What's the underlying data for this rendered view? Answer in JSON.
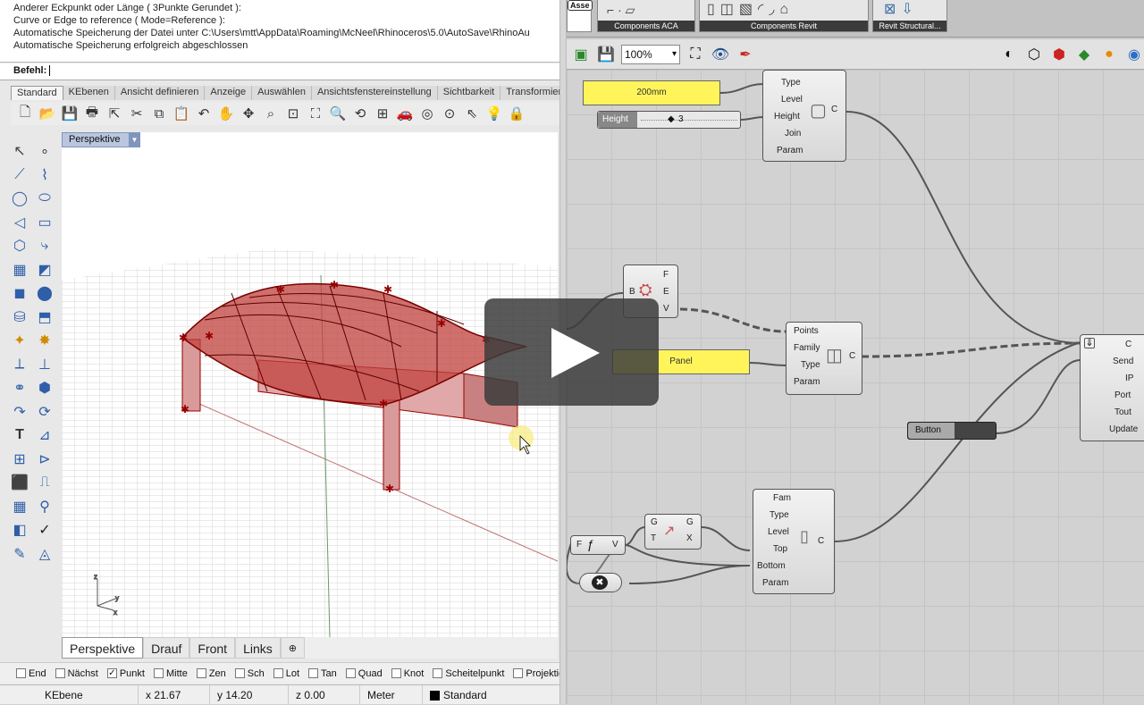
{
  "rhino": {
    "history": [
      "Anderer Eckpunkt oder Länge ( 3Punkte  Gerundet ):",
      "Curve or Edge to reference ( Mode=Reference ):",
      "Automatische Speicherung der Datei unter C:\\Users\\mtt\\AppData\\Roaming\\McNeel\\Rhinoceros\\5.0\\AutoSave\\RhinoAu",
      "Automatische Speicherung erfolgreich abgeschlossen"
    ],
    "command_label": "Befehl:",
    "tabs": [
      "Standard",
      "KEbenen",
      "Ansicht definieren",
      "Anzeige",
      "Auswählen",
      "Ansichtsfenstereinstellung",
      "Sichtbarkeit",
      "Transformier"
    ],
    "viewport_title": "Perspektive",
    "viewport_tabs": [
      "Perspektive",
      "Drauf",
      "Front",
      "Links",
      "⊕"
    ],
    "osnaps": [
      {
        "label": "End",
        "checked": false
      },
      {
        "label": "Nächst",
        "checked": false
      },
      {
        "label": "Punkt",
        "checked": true
      },
      {
        "label": "Mitte",
        "checked": false
      },
      {
        "label": "Zen",
        "checked": false
      },
      {
        "label": "Sch",
        "checked": false
      },
      {
        "label": "Lot",
        "checked": false
      },
      {
        "label": "Tan",
        "checked": false
      },
      {
        "label": "Quad",
        "checked": false
      },
      {
        "label": "Knot",
        "checked": false
      },
      {
        "label": "Scheitelpunkt",
        "checked": false
      },
      {
        "label": "Projektion",
        "checked": false
      }
    ],
    "status": {
      "layer": "KEbene",
      "x": "x 21.67",
      "y": "y 14.20",
      "z": "z 0.00",
      "unit": "Meter",
      "active_layer": "Standard"
    }
  },
  "grasshopper": {
    "ribbon_groups": [
      "Components ACA",
      "Components Revit",
      "Revit Structural..."
    ],
    "ribbon_tag": "Asse",
    "zoom": "100%",
    "panel_200": "200mm",
    "slider_name": "Height",
    "slider_value": "3",
    "panel_1": "Panel",
    "button_label": "Button",
    "comp_top": {
      "inputs": [
        "Type",
        "Level",
        "Height",
        "Join",
        "Param"
      ],
      "output": "C"
    },
    "comp_brep": {
      "input": "B",
      "outputs": [
        "F",
        "E",
        "V"
      ]
    },
    "comp_points": {
      "inputs": [
        "Points",
        "Family",
        "Type",
        "Param"
      ],
      "output": "C"
    },
    "comp_send": {
      "inputs": [
        "C",
        "Send",
        "IP",
        "Port",
        "Tout",
        "Update"
      ]
    },
    "comp_fn": {
      "input": "F",
      "output": "V"
    },
    "comp_vec": {
      "inputs": [
        "G",
        "T"
      ],
      "outputs": [
        "G",
        "X"
      ]
    },
    "comp_col": {
      "inputs": [
        "Fam",
        "Type",
        "Level",
        "Top",
        "Bottom",
        "Param"
      ],
      "output": "C"
    }
  }
}
